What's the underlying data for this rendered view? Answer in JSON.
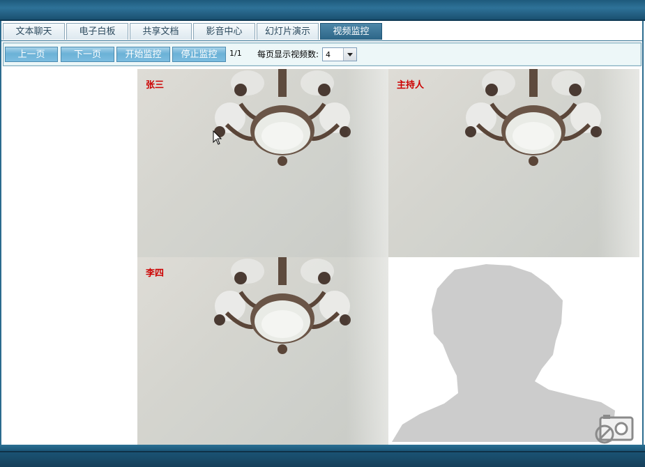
{
  "tabs": [
    {
      "label": "文本聊天",
      "active": false
    },
    {
      "label": "电子白板",
      "active": false
    },
    {
      "label": "共享文档",
      "active": false
    },
    {
      "label": "影音中心",
      "active": false
    },
    {
      "label": "幻灯片演示",
      "active": false
    },
    {
      "label": "视频监控",
      "active": true
    }
  ],
  "toolbar": {
    "prev_page": "上一页",
    "next_page": "下一页",
    "start_monitor": "开始监控",
    "stop_monitor": "停止监控",
    "page_indicator": "1/1",
    "per_page_label": "每页显示视频数:",
    "per_page_value": "4"
  },
  "videos": [
    {
      "name": "张三",
      "has_feed": true
    },
    {
      "name": "主持人",
      "has_feed": true
    },
    {
      "name": "李四",
      "has_feed": true
    },
    {
      "name": "",
      "has_feed": false
    }
  ],
  "colors": {
    "header": "#2e7298",
    "tab_active": "#2c6587",
    "toolbar_bg": "#edf7f8",
    "button": "#6bb1d6",
    "video_label": "#cc0000",
    "placeholder_silhouette": "#cccccc"
  },
  "icons": [
    "lamp-image",
    "person-silhouette-icon",
    "camera-off-icon",
    "mouse-cursor-icon",
    "dropdown-arrow-icon"
  ]
}
